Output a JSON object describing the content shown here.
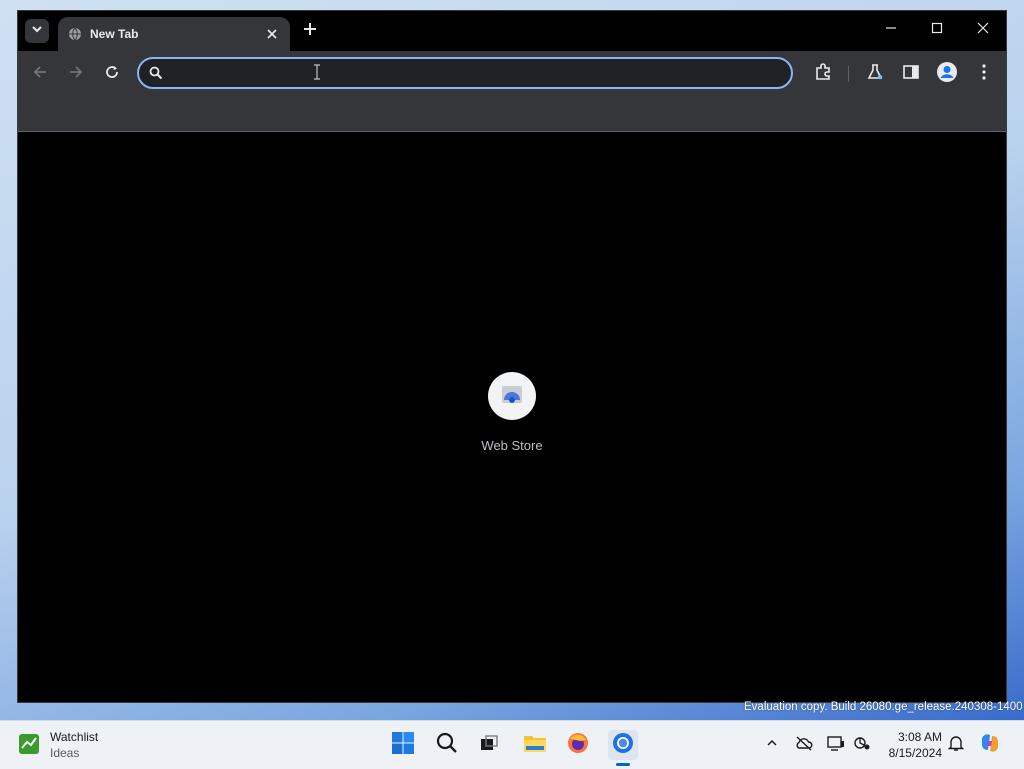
{
  "browser": {
    "tab": {
      "title": "New Tab",
      "favicon": "globe-icon"
    },
    "window_controls": [
      "minimize-icon",
      "maximize-icon",
      "close-icon"
    ],
    "omnibox": {
      "value": "",
      "placeholder": ""
    },
    "toolbar_icons": [
      "extensions-icon",
      "labs-icon",
      "side-panel-icon",
      "profile-icon",
      "menu-icon"
    ],
    "accent_color": "#8ab4f8"
  },
  "new_tab_page": {
    "shortcuts": [
      {
        "label": "Web Store",
        "icon": "web-store-icon"
      }
    ]
  },
  "watermark": {
    "text": "Evaluation copy. Build 26080.ge_release.240308-1400"
  },
  "taskbar": {
    "widget": {
      "title": "Watchlist",
      "subtitle": "Ideas",
      "icon": "stocks-icon"
    },
    "apps": [
      "start-icon",
      "search-icon",
      "task-view-icon",
      "file-explorer-icon",
      "firefox-icon",
      "chrome-icon"
    ],
    "tray": [
      "chevron-up-icon",
      "cloud-offline-icon",
      "display-icon",
      "location-icon",
      "notifications-icon",
      "copilot-icon"
    ],
    "clock": {
      "time": "3:08 AM",
      "date": "8/15/2024"
    }
  }
}
